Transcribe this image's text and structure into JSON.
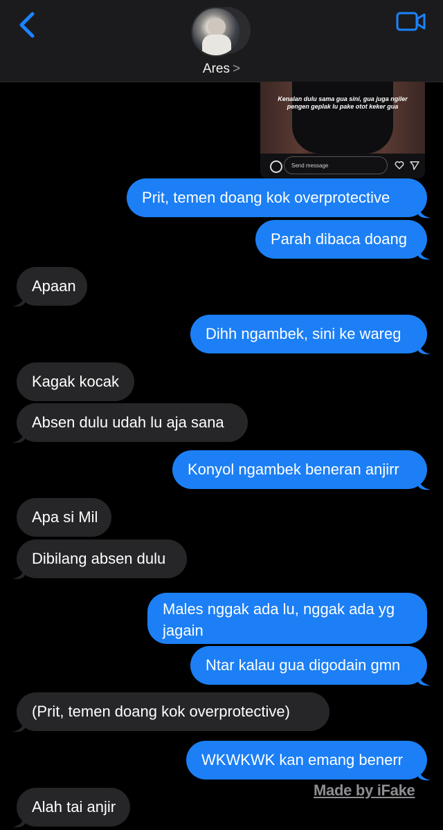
{
  "header": {
    "contact_name": "Ares",
    "chevron": ">"
  },
  "media": {
    "caption": "Kenalan dulu sama gua sini, gua juga ngiler pengen geplak lu pake otot keker gua",
    "input_placeholder": "Send message"
  },
  "messages": [
    {
      "side": "sent",
      "text": "Prit, temen doang kok overprotective"
    },
    {
      "side": "sent",
      "text": "Parah dibaca doang"
    },
    {
      "side": "recv",
      "text": "Apaan"
    },
    {
      "side": "sent",
      "text": "Dihh ngambek, sini ke wareg"
    },
    {
      "side": "recv",
      "text": "Kagak kocak"
    },
    {
      "side": "recv",
      "text": "Absen dulu udah lu aja sana"
    },
    {
      "side": "sent",
      "text": "Konyol ngambek beneran anjirr"
    },
    {
      "side": "recv",
      "text": "Apa si Mil"
    },
    {
      "side": "recv",
      "text": "Dibilang absen dulu"
    },
    {
      "side": "sent",
      "text": "Males nggak ada lu, nggak ada yg jagain"
    },
    {
      "side": "sent",
      "text": "Ntar kalau gua digodain gmn"
    },
    {
      "side": "recv",
      "text": "(Prit, temen doang kok overprotective)"
    },
    {
      "side": "sent",
      "text": "WKWKWK kan emang benerr"
    },
    {
      "side": "recv",
      "text": "Alah tai anjir"
    }
  ],
  "watermark": "Made by iFake",
  "colors": {
    "sent_bubble": "#1c7ff5",
    "received_bubble": "#262628",
    "accent": "#1a84ff",
    "background": "#000000"
  }
}
